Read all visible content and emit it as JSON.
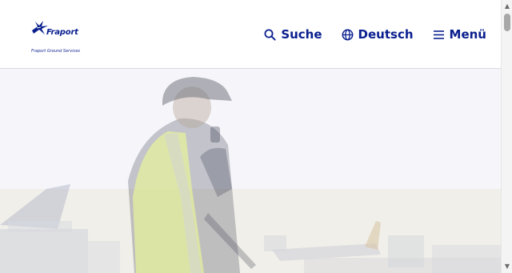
{
  "header": {
    "logo": {
      "brand": "Fraport",
      "tagline": "Fraport Ground Services"
    },
    "nav": {
      "search_label": "Suche",
      "language_label": "Deutsch",
      "menu_label": "Menü"
    }
  },
  "colors": {
    "brand_blue": "#0a1f8f",
    "header_bg": "#ffffff"
  },
  "icons": {
    "search": "search-icon",
    "language": "globe-icon",
    "menu": "hamburger-icon"
  },
  "hero": {
    "image": "airport-ground-worker-photo"
  },
  "scrollbar": {
    "up_glyph": "▲",
    "down_glyph": "▼"
  }
}
